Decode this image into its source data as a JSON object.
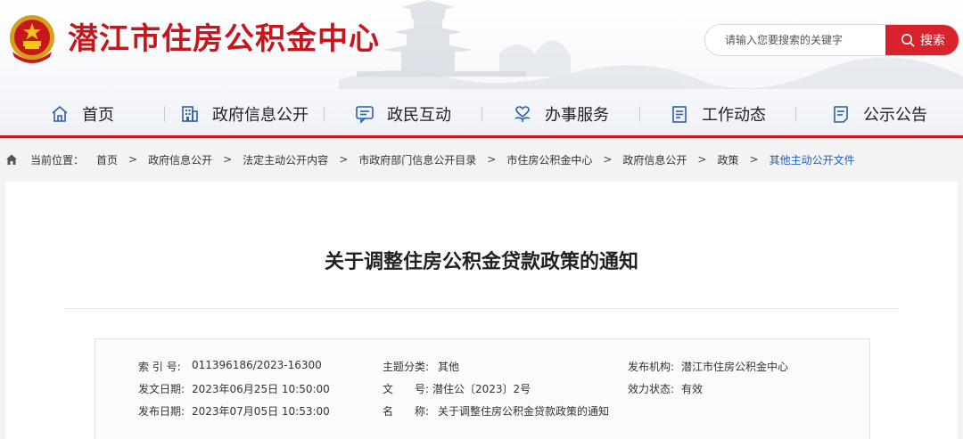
{
  "header": {
    "site_title": "潜江市住房公积金中心",
    "search": {
      "placeholder": "请输入您要搜索的关键字",
      "button_label": "搜索"
    }
  },
  "nav": {
    "items": [
      {
        "label": "首页",
        "icon": "home-icon"
      },
      {
        "label": "政府信息公开",
        "icon": "building-icon"
      },
      {
        "label": "政民互动",
        "icon": "chat-icon"
      },
      {
        "label": "办事服务",
        "icon": "heart-hand-icon"
      },
      {
        "label": "工作动态",
        "icon": "document-list-icon"
      },
      {
        "label": "公示公告",
        "icon": "notice-icon"
      }
    ]
  },
  "breadcrumb": {
    "lead": "当前位置：",
    "items": [
      "首页",
      "政府信息公开",
      "法定主动公开内容",
      "市政府部门信息公开目录",
      "市住房公积金中心",
      "政府信息公开",
      "政策",
      "其他主动公开文件"
    ],
    "separator": ">"
  },
  "article": {
    "title": "关于调整住房公积金贷款政策的通知",
    "meta": {
      "index_no": {
        "label": "索 引 号:",
        "value": "011396186/2023-16300"
      },
      "category": {
        "label": "主题分类:",
        "value": "其他"
      },
      "publisher": {
        "label": "发布机构:",
        "value": "潜江市住房公积金中心"
      },
      "issue_date": {
        "label": "发文日期:",
        "value": "2023年06月25日 10:50:00"
      },
      "doc_no": {
        "label": "文　　号:",
        "value": "潜住公〔2023〕2号"
      },
      "status": {
        "label": "效力状态:",
        "value": "有效"
      },
      "publish_date": {
        "label": "发布日期:",
        "value": "2023年07月05日 10:53:00"
      },
      "name": {
        "label": "名　　称:",
        "value": "关于调整住房公积金贷款政策的通知"
      }
    }
  },
  "colors": {
    "brand_red": "#c8161d",
    "search_red": "#d9232c",
    "link_blue": "#1f5fbf"
  }
}
